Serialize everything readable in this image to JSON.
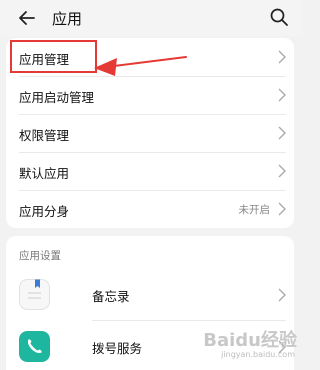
{
  "header": {
    "title": "应用",
    "back_icon": "back-arrow-icon",
    "search_icon": "search-icon"
  },
  "main_list": {
    "items": [
      {
        "label": "应用管理"
      },
      {
        "label": "应用启动管理"
      },
      {
        "label": "权限管理"
      },
      {
        "label": "默认应用"
      },
      {
        "label": "应用分身",
        "status": "未开启"
      }
    ]
  },
  "app_settings": {
    "section_title": "应用设置",
    "items": [
      {
        "label": "备忘录",
        "icon": "notepad-icon"
      },
      {
        "label": "拨号服务",
        "icon": "phone-icon",
        "icon_color": "#1fb6a0"
      }
    ]
  },
  "annotation": {
    "highlight_color": "#e53935"
  },
  "watermark": {
    "main": "Baidu经验",
    "sub": "jingyan.baidu.com"
  }
}
